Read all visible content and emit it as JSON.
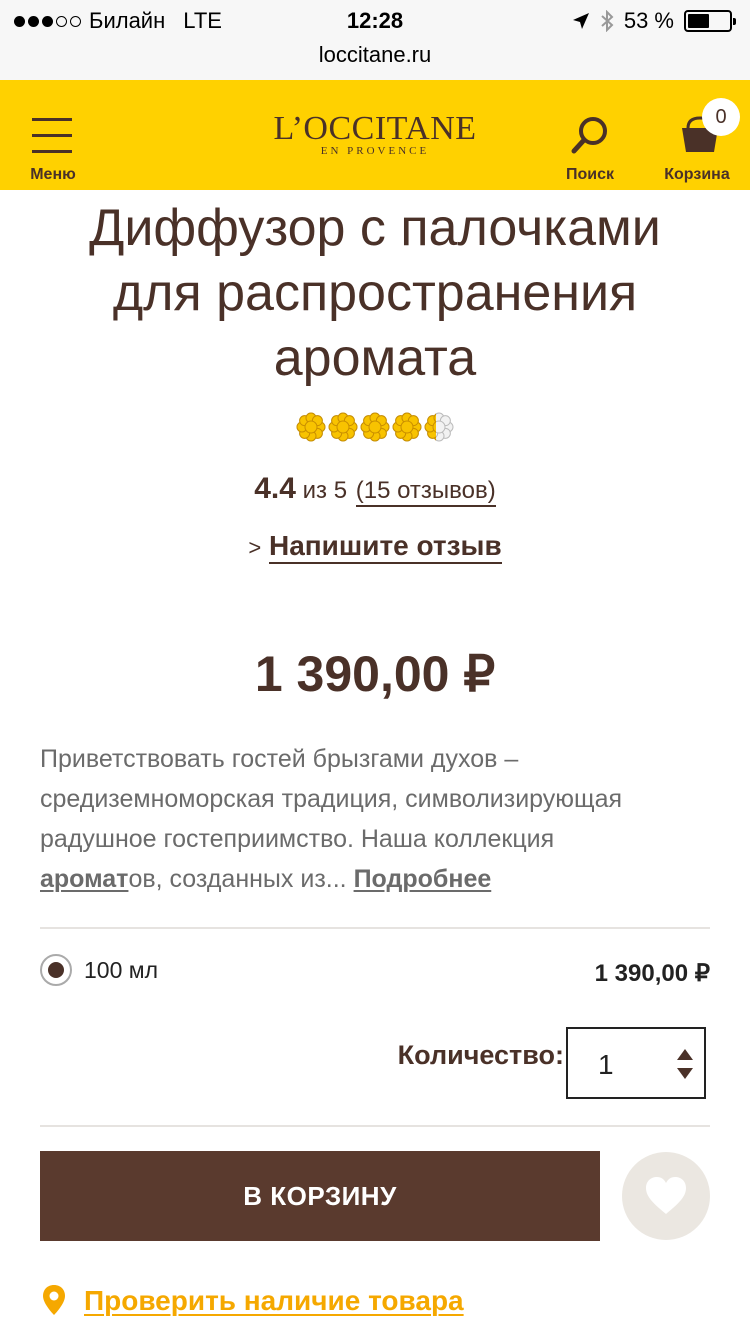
{
  "status_bar": {
    "carrier": "Билайн",
    "network": "LTE",
    "time": "12:28",
    "battery_text": "53 %",
    "battery_level": 0.53,
    "signal_bars_filled": 3,
    "signal_bars_total": 5
  },
  "browser": {
    "url": "loccitane.ru"
  },
  "header": {
    "menu_label": "Меню",
    "logo_main": "L’OCCITANE",
    "logo_sub": "EN PROVENCE",
    "search_label": "Поиск",
    "cart_label": "Корзина",
    "cart_count": "0",
    "background_color": "#ffd100"
  },
  "product": {
    "title": "Диффузор с палочками для распространения аромата",
    "rating_value": "4.4",
    "rating_scale_text": "из 5",
    "reviews_text": "(15 отзывов)",
    "rating_fraction": 0.88,
    "write_review_prefix": ">",
    "write_review_label": "Напишите отзыв",
    "price": "1 390,00 ₽",
    "description_line1": "Приветствовать гостей брызгами духов –",
    "description_line2": "средиземноморская традиция, символизирующая",
    "description_line3": "радушное гостеприимство. Наша коллекция",
    "description_link": "аромат",
    "description_tail": "ов, созданных из...",
    "read_more": "Подробнее",
    "variant_size": "100 мл",
    "variant_price": "1 390,00 ₽",
    "variant_selected": true,
    "quantity_label": "Количество:",
    "quantity_value": "1",
    "add_to_cart": "В КОРЗИНУ",
    "check_availability": "Проверить наличие товара",
    "accent_color": "#5a3a2e",
    "link_color": "#f5a800"
  }
}
